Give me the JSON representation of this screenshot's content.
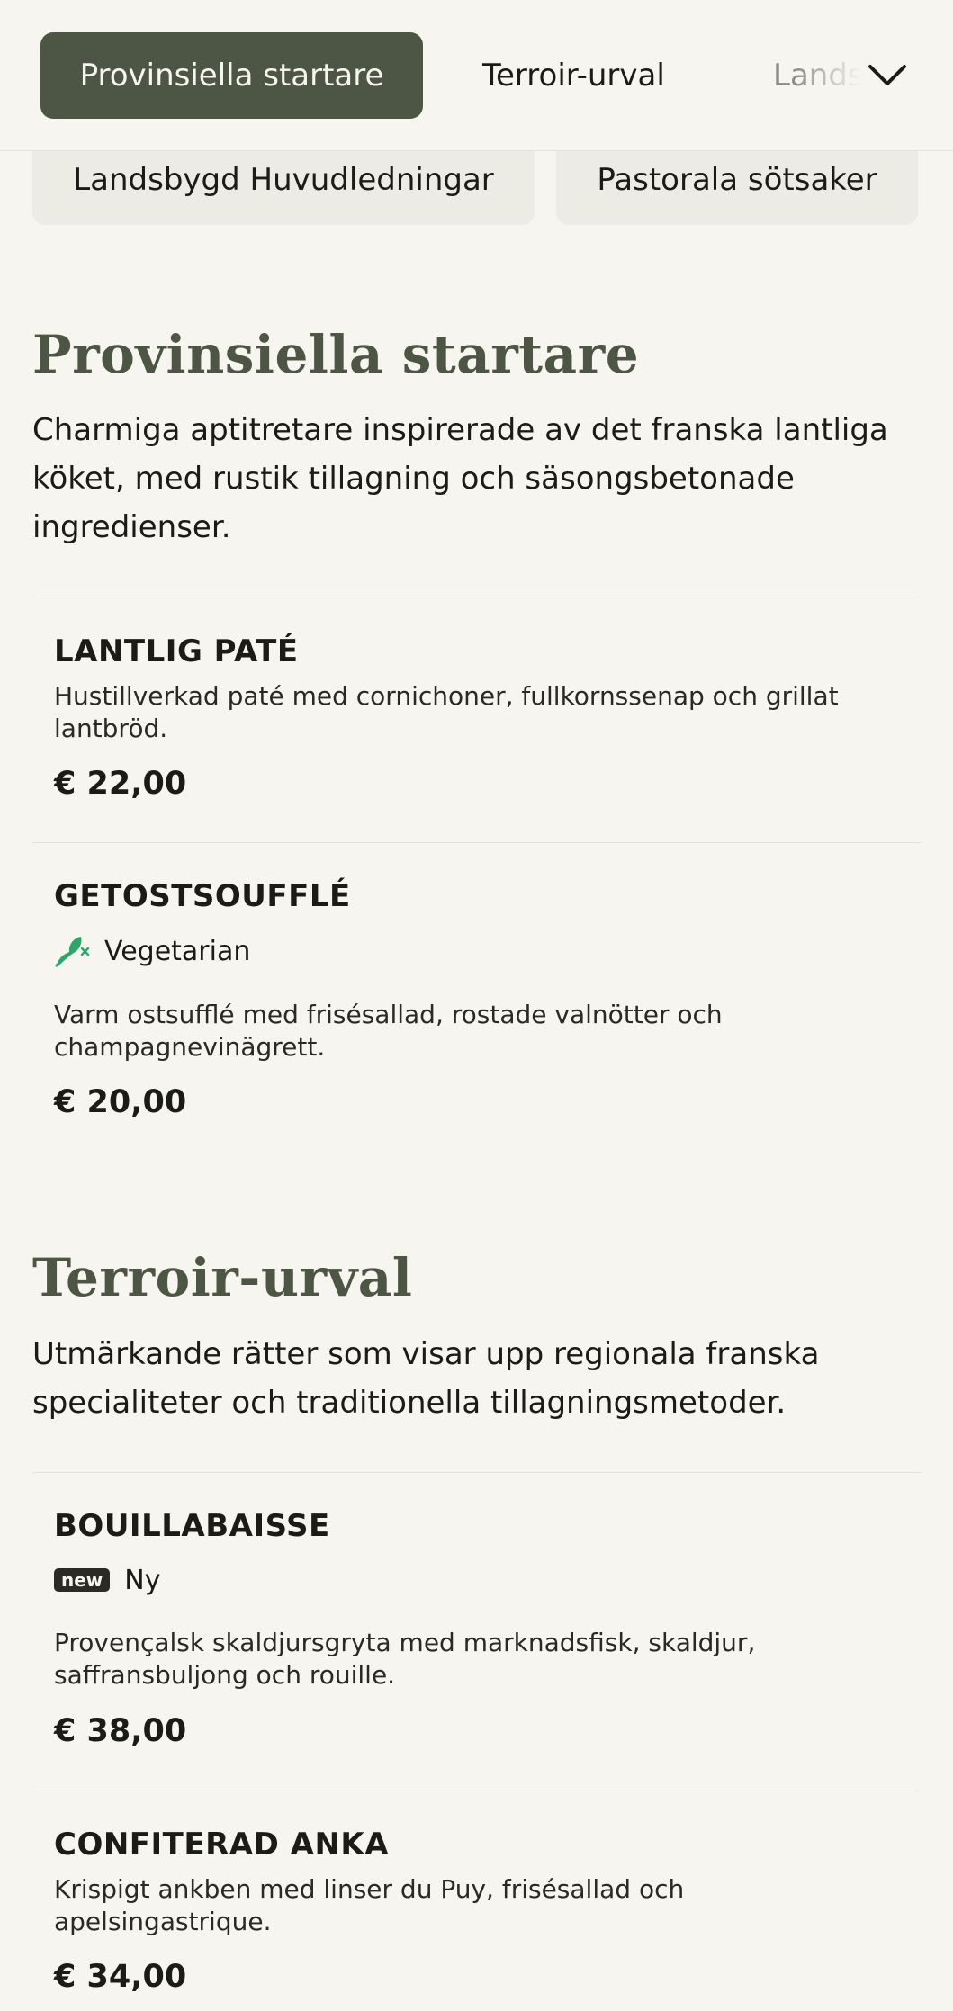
{
  "nav": {
    "tabs": [
      {
        "label": "Provinsiella startare"
      },
      {
        "label": "Terroir-urval"
      },
      {
        "label": "Landsbygd Huvudledningar"
      }
    ],
    "categories": [
      {
        "label": "Landsbygd Huvudledningar"
      },
      {
        "label": "Pastorala sötsaker"
      }
    ],
    "expand_icon": "chevron-down-icon"
  },
  "sections": [
    {
      "title": "Provinsiella startare",
      "description": "Charmiga aptitretare inspirerade av det franska lantliga köket, med rustik tillagning och säsongsbetonade ingredienser.",
      "items": [
        {
          "name": "LANTLIG PATÉ",
          "description": "Hustillverkad paté med cornichoner, fullkornssenap och grillat lantbröd.",
          "price": "€ 22,00"
        },
        {
          "name": "GETOSTSOUFFLÉ",
          "tag": {
            "icon": "leaf-icon",
            "label": "Vegetarian",
            "color": "#2fa56c"
          },
          "description": "Varm ostsufflé med frisésallad, rostade valnötter och champagnevinägrett.",
          "price": "€ 20,00"
        }
      ]
    },
    {
      "title": "Terroir-urval",
      "description": "Utmärkande rätter som visar upp regionala franska specialiteter och traditionella tillagningsmetoder.",
      "items": [
        {
          "name": "BOUILLABAISSE",
          "tag": {
            "badge": "new",
            "label": "Ny"
          },
          "description": "Provençalsk skaldjursgryta med marknadsfisk, skaldjur, saffransbuljong och rouille.",
          "price": "€ 38,00"
        },
        {
          "name": "CONFITERAD ANKA",
          "description": "Krispigt ankben med linser du Puy, frisésallad och apelsingastrique.",
          "price": "€ 34,00"
        }
      ]
    }
  ],
  "colors": {
    "accent": "#4d5544",
    "background": "#f7f5ef",
    "chip": "#ecebe4",
    "vegetarian": "#2fa56c"
  }
}
